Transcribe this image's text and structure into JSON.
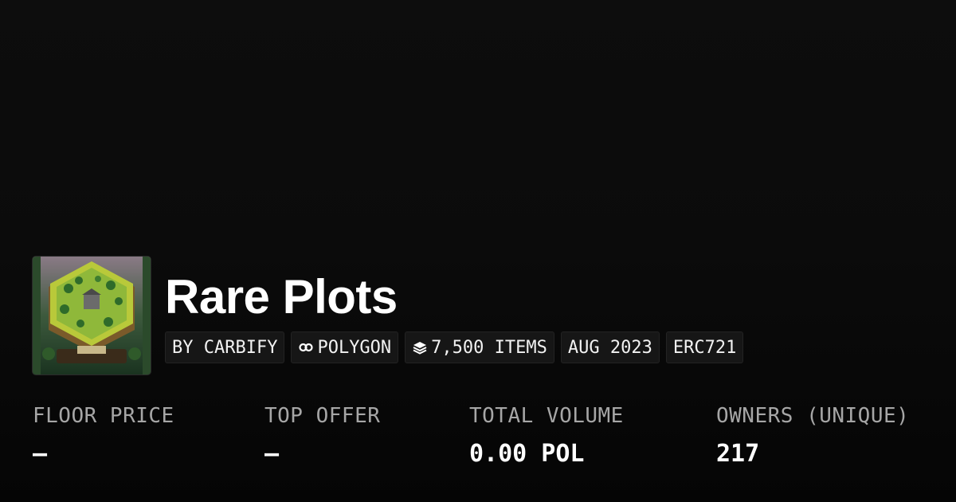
{
  "collection": {
    "title": "Rare Plots",
    "thumbnail_icon": "hex-island-artwork",
    "tags": [
      {
        "label": "BY CARBIFY",
        "icon": null
      },
      {
        "label": "POLYGON",
        "icon": "link-icon"
      },
      {
        "label": "7,500 ITEMS",
        "icon": "layers-icon"
      },
      {
        "label": "AUG 2023",
        "icon": null
      },
      {
        "label": "ERC721",
        "icon": null
      }
    ]
  },
  "stats": [
    {
      "label": "FLOOR PRICE",
      "value": "–"
    },
    {
      "label": "TOP OFFER",
      "value": "–"
    },
    {
      "label": "TOTAL VOLUME",
      "value": "0.00 POL"
    },
    {
      "label": "OWNERS (UNIQUE)",
      "value": "217"
    }
  ],
  "colors": {
    "background": "#0b0b0b",
    "tag_background": "#161616",
    "label_gray": "#a6a6a6",
    "text": "#ffffff"
  }
}
